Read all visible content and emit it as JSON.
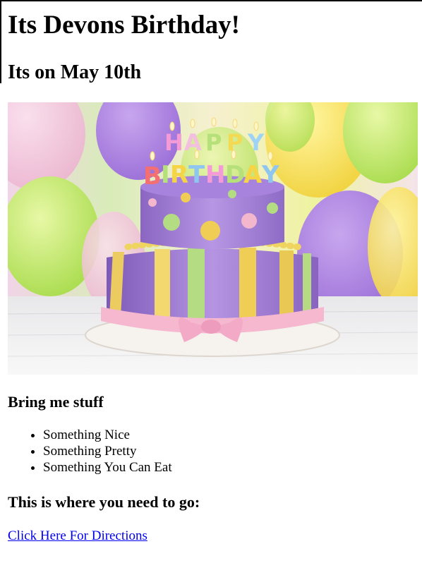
{
  "page": {
    "title": "Its Devons Birthday!",
    "date_line": "Its on May 10th",
    "image": {
      "icon": "birthday-cake-photo",
      "cake_text": [
        "HAPPY",
        "BIRTHDAY"
      ]
    },
    "bring_heading": "Bring me stuff",
    "bring_items": [
      "Something Nice",
      "Something Pretty",
      "Something You Can Eat"
    ],
    "where_heading": "This is where you need to go:",
    "directions_link": "Click Here For Directions"
  },
  "colors": {
    "link": "#0000ee",
    "text": "#000000",
    "background": "#ffffff"
  }
}
